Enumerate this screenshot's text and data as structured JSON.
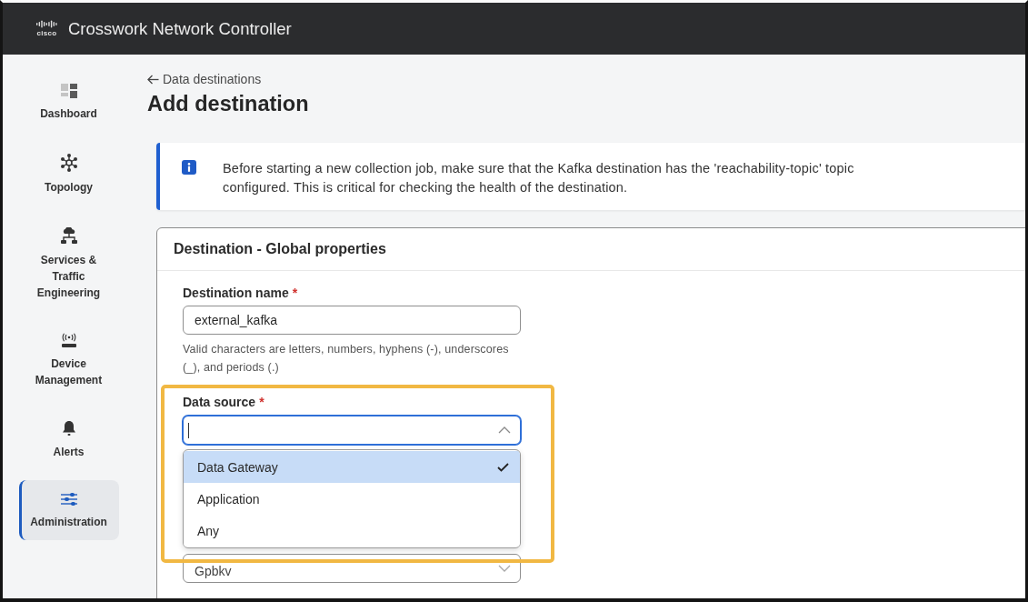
{
  "header": {
    "logo_text": "cisco",
    "title": "Crosswork Network Controller"
  },
  "sidebar": {
    "items": [
      {
        "kind": "dashboard",
        "label": "Dashboard",
        "selected": false
      },
      {
        "kind": "topology",
        "label": "Topology",
        "selected": false
      },
      {
        "kind": "services",
        "label": "Services & Traffic Engineering",
        "selected": false
      },
      {
        "kind": "devices",
        "label": "Device Management",
        "selected": false
      },
      {
        "kind": "alerts",
        "label": "Alerts",
        "selected": false
      },
      {
        "kind": "administration",
        "label": "Administration",
        "selected": true
      }
    ]
  },
  "page": {
    "back_link": "Data destinations",
    "title": "Add destination"
  },
  "info_banner": {
    "text": "Before starting a new collection job, make sure that the Kafka destination has the 'reachability-topic' topic configured. This is critical for checking the health of the destination."
  },
  "card": {
    "title": "Destination - Global properties",
    "fields": [
      {
        "kind": "text",
        "label": "Destination name",
        "required_mark": "*",
        "value": "external_kafka",
        "help": "Valid characters are letters, numbers, hyphens (-), underscores (_), and periods (.)"
      },
      {
        "kind": "select",
        "label": "Data source",
        "required_mark": "*",
        "focused": true,
        "expanded": true,
        "highlighted": true,
        "options": [
          {
            "label": "Data Gateway",
            "selected": true
          },
          {
            "label": "Application",
            "selected": false
          },
          {
            "label": "Any",
            "selected": false
          }
        ]
      },
      {
        "kind": "select",
        "value": "Gpbkv",
        "focused": false,
        "expanded": false,
        "highlighted": false
      }
    ]
  }
}
